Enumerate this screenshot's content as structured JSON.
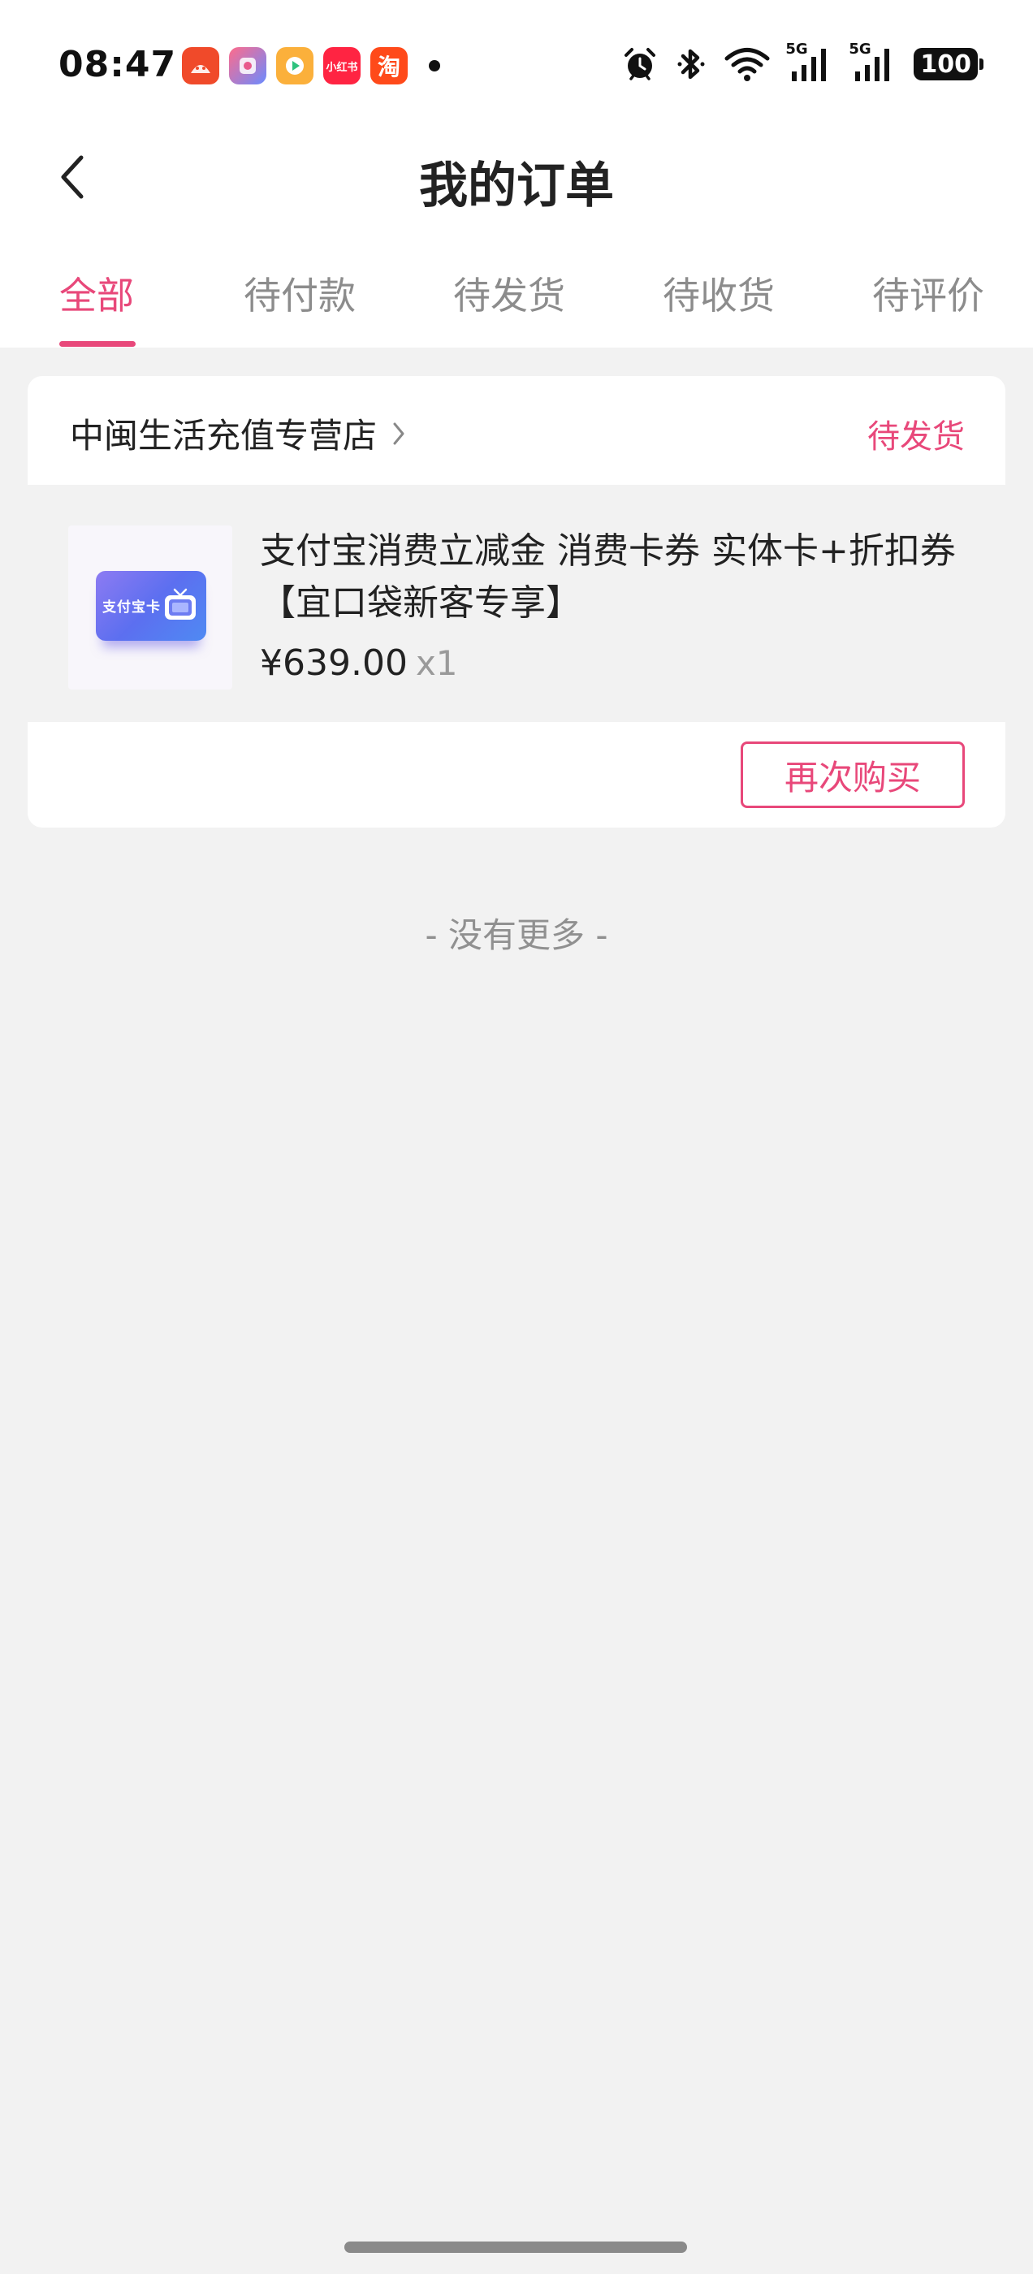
{
  "status_bar": {
    "time": "08:47",
    "apps": [
      {
        "icon": "app-icon-1",
        "color": "#f04a2a",
        "label": ""
      },
      {
        "icon": "app-icon-2",
        "color": "#e85a8c",
        "label": ""
      },
      {
        "icon": "video-app-icon",
        "color": "#fbb03b",
        "label": ""
      },
      {
        "icon": "xiaohongshu-icon",
        "color": "#ff2442",
        "label": "小红书"
      },
      {
        "icon": "taobao-icon",
        "color": "#ff4a1a",
        "label": "淘"
      }
    ],
    "signal_label_1": "5G",
    "signal_label_2": "5G",
    "battery": "100"
  },
  "header": {
    "title": "我的订单"
  },
  "tabs": [
    {
      "label": "全部",
      "active": true
    },
    {
      "label": "待付款",
      "active": false
    },
    {
      "label": "待发货",
      "active": false
    },
    {
      "label": "待收货",
      "active": false
    },
    {
      "label": "待评价",
      "active": false
    }
  ],
  "order": {
    "store_name": "中闽生活充值专营店",
    "status": "待发货",
    "thumbnail_text": "支付宝卡",
    "product_title": "支付宝消费立减金 消费卡券 实体卡+折扣券【宜口袋新客专享】",
    "price": "¥639.00",
    "quantity": "x1",
    "rebuy_label": "再次购买"
  },
  "footer_text": "- 没有更多 -",
  "colors": {
    "accent": "#e8487a",
    "background": "#f2f2f2",
    "card": "#ffffff",
    "muted_text": "#8c8c8c"
  }
}
